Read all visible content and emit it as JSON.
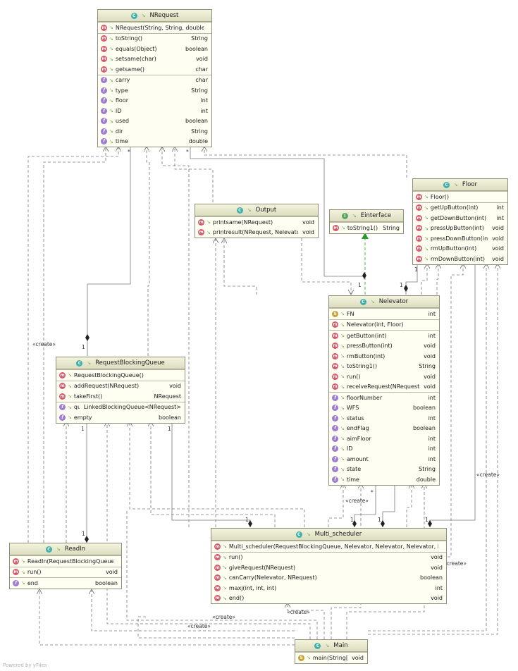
{
  "classes": {
    "nrequest": {
      "name": "NRequest",
      "kind": "c",
      "sections": [
        [
          {
            "icon": "m",
            "name": "NRequest(String, String, double)",
            "type": ""
          }
        ],
        [
          {
            "icon": "m",
            "name": "toString()",
            "type": "String"
          },
          {
            "icon": "m",
            "name": "equals(Object)",
            "type": "boolean"
          },
          {
            "icon": "m",
            "name": "setsame(char)",
            "type": "void"
          },
          {
            "icon": "m",
            "name": "getsame()",
            "type": "char"
          }
        ],
        [
          {
            "icon": "f",
            "name": "carry",
            "type": "char"
          },
          {
            "icon": "f",
            "name": "type",
            "type": "String"
          },
          {
            "icon": "f",
            "name": "floor",
            "type": "int"
          },
          {
            "icon": "f",
            "name": "ID",
            "type": "int"
          },
          {
            "icon": "f",
            "name": "used",
            "type": "boolean"
          },
          {
            "icon": "f",
            "name": "dir",
            "type": "String"
          },
          {
            "icon": "f",
            "name": "time",
            "type": "double"
          }
        ]
      ]
    },
    "output": {
      "name": "Output",
      "kind": "c",
      "sections": [
        [
          {
            "icon": "m",
            "name": "printsame(NRequest)",
            "type": "void"
          },
          {
            "icon": "m",
            "name": "printresult(NRequest, Nelevator)",
            "type": "void"
          }
        ]
      ]
    },
    "einterface": {
      "name": "Einterface",
      "kind": "i",
      "sections": [
        [
          {
            "icon": "m",
            "name": "toString1()",
            "type": "String"
          }
        ]
      ]
    },
    "floor": {
      "name": "Floor",
      "kind": "c",
      "sections": [
        [
          {
            "icon": "m",
            "name": "Floor()",
            "type": ""
          }
        ],
        [
          {
            "icon": "m",
            "name": "getUpButton(int)",
            "type": "int"
          },
          {
            "icon": "m",
            "name": "getDownButton(int)",
            "type": "int"
          },
          {
            "icon": "m",
            "name": "pressUpButton(int)",
            "type": "void"
          },
          {
            "icon": "m",
            "name": "pressDownButton(int)",
            "type": "void"
          },
          {
            "icon": "m",
            "name": "rmUpButton(int)",
            "type": "void"
          },
          {
            "icon": "m",
            "name": "rmDownButton(int)",
            "type": "void"
          }
        ]
      ]
    },
    "nelevator": {
      "name": "Nelevator",
      "kind": "c",
      "sections": [
        [
          {
            "icon": "s",
            "name": "FN",
            "type": "int"
          }
        ],
        [
          {
            "icon": "m",
            "name": "Nelevator(int, Floor)",
            "type": ""
          }
        ],
        [
          {
            "icon": "m",
            "name": "getButton(int)",
            "type": "int"
          },
          {
            "icon": "m",
            "name": "pressButton(int)",
            "type": "void"
          },
          {
            "icon": "m",
            "name": "rmButton(int)",
            "type": "void"
          },
          {
            "icon": "m",
            "name": "toString1()",
            "type": "String"
          },
          {
            "icon": "m",
            "name": "run()",
            "type": "void"
          },
          {
            "icon": "m",
            "name": "receiveRequest(NRequest)",
            "type": "void"
          }
        ],
        [
          {
            "icon": "f",
            "name": "floorNumber",
            "type": "int"
          },
          {
            "icon": "f",
            "name": "WFS",
            "type": "boolean"
          },
          {
            "icon": "f",
            "name": "status",
            "type": "int"
          },
          {
            "icon": "f",
            "name": "endFlag",
            "type": "boolean"
          },
          {
            "icon": "f",
            "name": "aimFloor",
            "type": "int"
          },
          {
            "icon": "f",
            "name": "ID",
            "type": "int"
          },
          {
            "icon": "f",
            "name": "amount",
            "type": "int"
          },
          {
            "icon": "f",
            "name": "state",
            "type": "String"
          },
          {
            "icon": "f",
            "name": "time",
            "type": "double"
          }
        ]
      ]
    },
    "rbq": {
      "name": "RequestBlockingQueue",
      "kind": "c",
      "sections": [
        [
          {
            "icon": "m",
            "name": "RequestBlockingQueue()",
            "type": ""
          }
        ],
        [
          {
            "icon": "m",
            "name": "addRequest(NRequest)",
            "type": "void"
          },
          {
            "icon": "m",
            "name": "takeFirst()",
            "type": "NRequest"
          }
        ],
        [
          {
            "icon": "f",
            "name": "queue",
            "type": "LinkedBlockingQueue<NRequest>"
          },
          {
            "icon": "f",
            "name": "empty",
            "type": "boolean"
          }
        ]
      ]
    },
    "readin": {
      "name": "ReadIn",
      "kind": "c",
      "sections": [
        [
          {
            "icon": "m",
            "name": "ReadIn(RequestBlockingQueue)",
            "type": ""
          }
        ],
        [
          {
            "icon": "m",
            "name": "run()",
            "type": "void"
          }
        ],
        [
          {
            "icon": "f",
            "name": "end",
            "type": "boolean"
          }
        ]
      ]
    },
    "multi": {
      "name": "Multi_scheduler",
      "kind": "c",
      "sections": [
        [
          {
            "icon": "m",
            "name": "Multi_scheduler(RequestBlockingQueue, Nelevator, Nelevator, Nelevator, Floor)",
            "type": ""
          }
        ],
        [
          {
            "icon": "m",
            "name": "run()",
            "type": "void"
          },
          {
            "icon": "m",
            "name": "giveRequest(NRequest)",
            "type": "void"
          },
          {
            "icon": "m",
            "name": "canCarry(Nelevator, NRequest)",
            "type": "boolean"
          },
          {
            "icon": "m",
            "name": "maxj(int, int, int)",
            "type": "int"
          },
          {
            "icon": "m",
            "name": "end()",
            "type": "void"
          }
        ]
      ]
    },
    "main": {
      "name": "Main",
      "kind": "c",
      "sections": [
        [
          {
            "icon": "s",
            "name": "main(String[])",
            "type": "void"
          }
        ]
      ]
    }
  },
  "edge_labels": {
    "create": "«create»",
    "one": "1",
    "many": "*"
  },
  "footer": "Powered by yFiles"
}
